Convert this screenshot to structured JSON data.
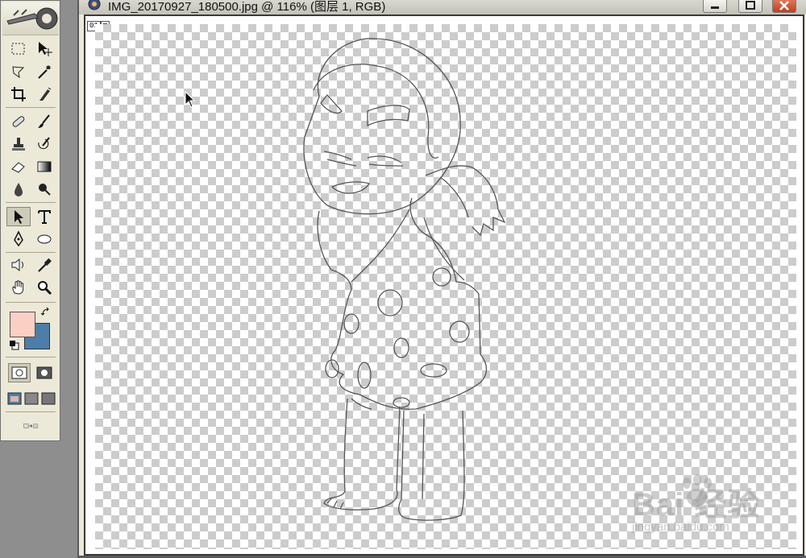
{
  "window": {
    "title": "IMG_20170927_180500.jpg @ 116% (图层 1, RGB)",
    "buttons": [
      "minimize",
      "maximize",
      "close"
    ]
  },
  "layer_badge": [
    "01",
    "⊠"
  ],
  "toolbox": {
    "tools": [
      "rectangular-marquee",
      "move",
      "lasso",
      "magic-wand",
      "crop",
      "slice",
      "healing-brush",
      "brush",
      "clone-stamp",
      "history-brush",
      "eraser",
      "gradient",
      "blur",
      "dodge",
      "path-selection",
      "type",
      "pen",
      "ellipse",
      "notes",
      "eyedropper",
      "hand",
      "zoom"
    ],
    "active_tool": "path-selection",
    "foreground_color": "#fad0c4",
    "background_color": "#4d7ea8"
  },
  "colors": {
    "checker_dark": "#cccccc",
    "toolbox_bg": "#ece9d8",
    "stroke": "#555555"
  },
  "watermark": {
    "brand": "Bai 经验",
    "url": "jingyan.baidu.com"
  }
}
